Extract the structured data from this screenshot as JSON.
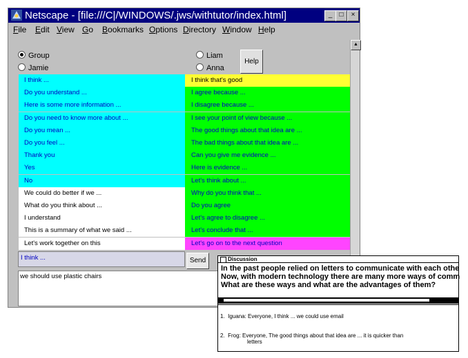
{
  "window": {
    "title": "Netscape - [file:///C|/WINDOWS/.jws/withtutor/index.html]",
    "controls": [
      "_",
      "□",
      "×"
    ]
  },
  "menu": [
    "File",
    "Edit",
    "View",
    "Go",
    "Bookmarks",
    "Options",
    "Directory",
    "Window",
    "Help"
  ],
  "radios": [
    {
      "label": "Group",
      "checked": true
    },
    {
      "label": "Jamie",
      "checked": false
    },
    {
      "label": "Liam",
      "checked": false
    },
    {
      "label": "Anna",
      "checked": false
    }
  ],
  "help_label": "Help",
  "left_phrases": [
    {
      "text": "I think ...",
      "color": "cyan"
    },
    {
      "text": "Do you understand ...",
      "color": "cyan"
    },
    {
      "text": "Here is some more information ...",
      "color": "cyan"
    },
    {
      "text": "Do you need to know more about ...",
      "color": "cyan"
    },
    {
      "text": "Do you mean ...",
      "color": "cyan"
    },
    {
      "text": "Do you feel ...",
      "color": "cyan"
    },
    {
      "text": "Thank you",
      "color": "cyan"
    },
    {
      "text": "Yes",
      "color": "cyan"
    },
    {
      "text": "No",
      "color": "cyan"
    },
    {
      "text": "We could do better if we ...",
      "color": "white"
    },
    {
      "text": "What do you think about ...",
      "color": "white"
    },
    {
      "text": "I understand",
      "color": "white"
    },
    {
      "text": "This is a summary of what we said ...",
      "color": "white"
    },
    {
      "text": "Let's work together on this",
      "color": "white"
    }
  ],
  "right_phrases": [
    {
      "text": "I think that's good",
      "color": "yellow"
    },
    {
      "text": "I agree because ...",
      "color": "green"
    },
    {
      "text": "I disagree because ...",
      "color": "green"
    },
    {
      "text": "I see your point of view because ...",
      "color": "green"
    },
    {
      "text": "The good things about that idea are ...",
      "color": "green"
    },
    {
      "text": "The bad things about that idea are ...",
      "color": "green"
    },
    {
      "text": "Can you give me evidence ...",
      "color": "green"
    },
    {
      "text": "Here is evidence ...",
      "color": "green"
    },
    {
      "text": "Let's think about ...",
      "color": "green"
    },
    {
      "text": "Why do you think that ...",
      "color": "green"
    },
    {
      "text": "Do you agree",
      "color": "green"
    },
    {
      "text": "Let's agree to disagree ...",
      "color": "green"
    },
    {
      "text": "Let's conclude that ...",
      "color": "green"
    },
    {
      "text": "Let's go on to the next question",
      "color": "magenta"
    }
  ],
  "compose_value": "I think ...",
  "send_label": "Send",
  "log_text": "we should use plastic chairs",
  "discussion": {
    "title": "Discussion",
    "question_lines": [
      "In the past people relied on letters to communicate with each other.",
      "Now, with modern technology there are many more ways of communi",
      "What are these ways and what are the advantages of them?"
    ],
    "posts": [
      {
        "num": "1.",
        "text": "Iguana: Everyone, I think ... we could use email",
        "cont": ""
      },
      {
        "num": "2.",
        "text": "Frog: Everyone, The good things about that idea are ... it is quicker than",
        "cont": "letters"
      }
    ]
  },
  "colors": {
    "cyan": "#00ffff",
    "green": "#00ff00",
    "yellow": "#ffff33",
    "magenta": "#ff44ff",
    "title_bar": "#000080",
    "chrome": "#c0c0c0"
  }
}
